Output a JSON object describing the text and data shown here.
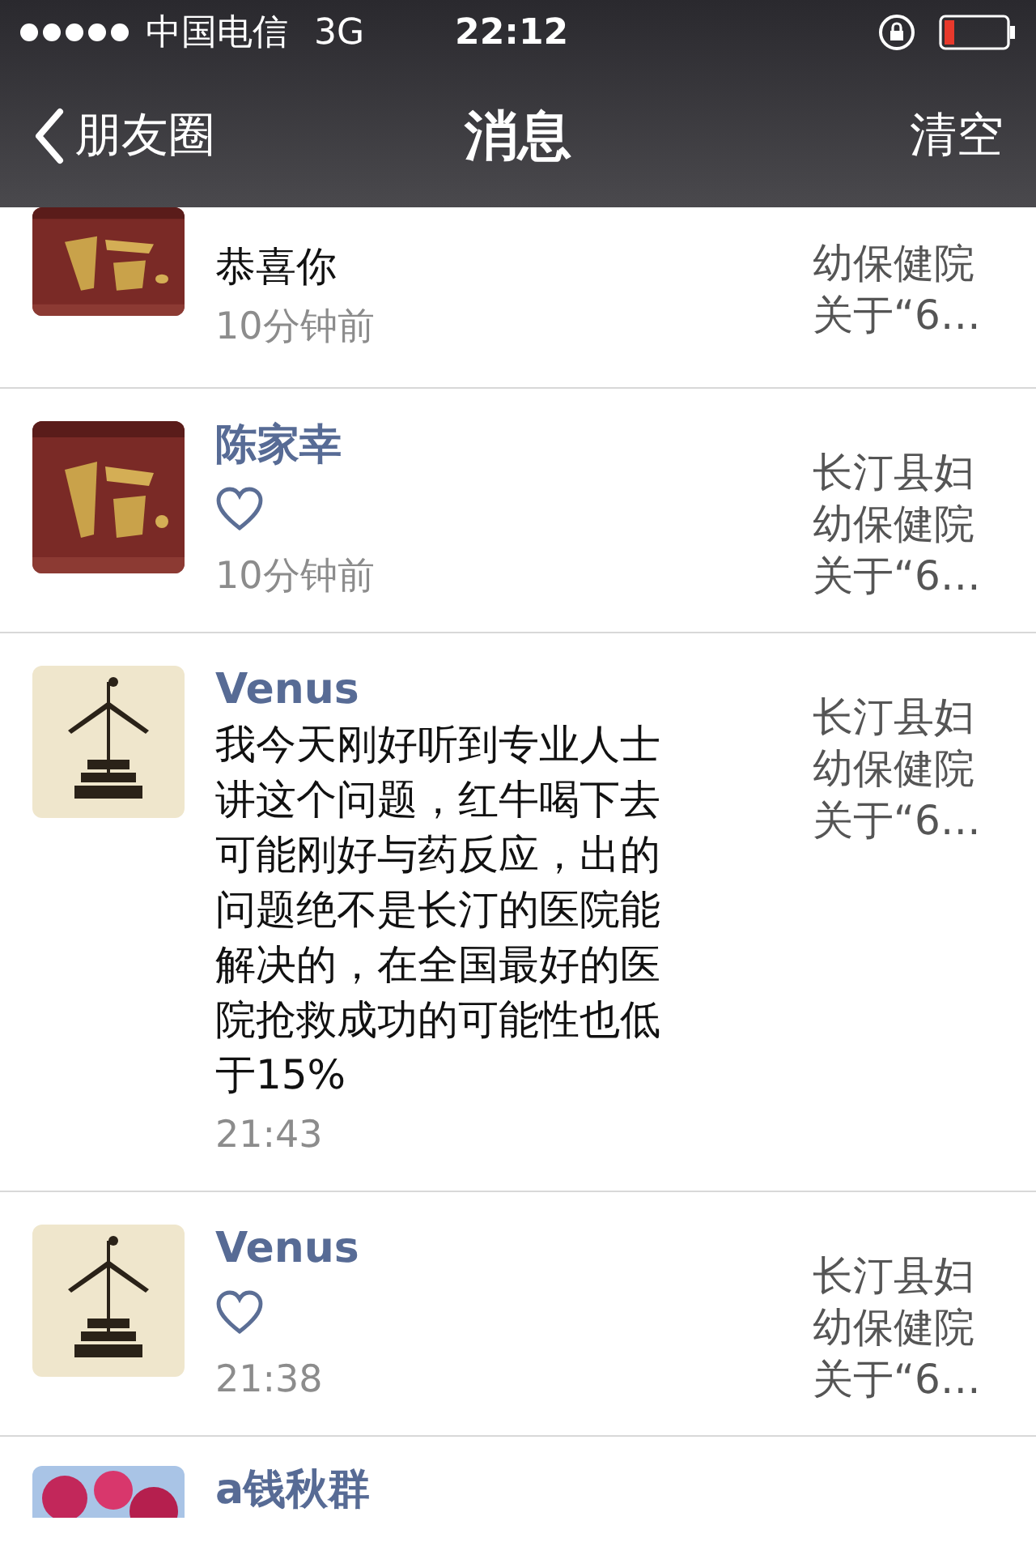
{
  "status_bar": {
    "carrier": "中国电信",
    "network": "3G",
    "time": "22:12"
  },
  "nav": {
    "back": "朋友圈",
    "title": "消息",
    "action": "清空"
  },
  "rows": [
    {
      "kind": "clipped_top",
      "avatar": {
        "kind": "plaque"
      },
      "comment": "恭喜你",
      "liked": false,
      "time": "10分钟前",
      "preview": [
        "幼保健院",
        "关于“6…"
      ]
    },
    {
      "kind": "full",
      "avatar": {
        "kind": "plaque"
      },
      "name": "陈家幸",
      "liked": true,
      "time": "10分钟前",
      "preview": [
        "长汀县妇",
        "幼保健院",
        "关于“6…"
      ]
    },
    {
      "kind": "full",
      "avatar": {
        "kind": "tower"
      },
      "name": "Venus",
      "comment": "我今天刚好听到专业人士讲这个问题，红牛喝下去可能刚好与药反应，出的问题绝不是长汀的医院能解决的，在全国最好的医院抢救成功的可能性也低于15%",
      "liked": false,
      "time": "21:43",
      "preview": [
        "长汀县妇",
        "幼保健院",
        "关于“6…"
      ]
    },
    {
      "kind": "full",
      "avatar": {
        "kind": "tower"
      },
      "name": "Venus",
      "liked": true,
      "time": "21:38",
      "preview": [
        "长汀县妇",
        "幼保健院",
        "关于“6…"
      ]
    },
    {
      "kind": "clipped_bottom",
      "avatar": {
        "kind": "blossom"
      },
      "name": "a钱秋群",
      "liked": false
    }
  ]
}
